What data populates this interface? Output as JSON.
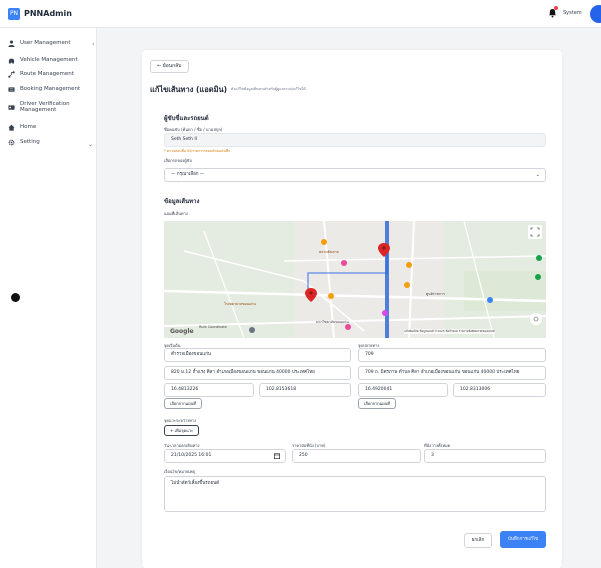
{
  "app": {
    "title": "PNNAdmin",
    "logo_text": "PN",
    "user_name": "System"
  },
  "sidebar": {
    "items": [
      {
        "label": "User Management"
      },
      {
        "label": "Vehicle Management"
      },
      {
        "label": "Route Management"
      },
      {
        "label": "Booking Management"
      },
      {
        "label": "Driver Verification Management"
      },
      {
        "label": "Home"
      },
      {
        "label": "Setting"
      }
    ]
  },
  "page": {
    "back_label": "← ย้อนกลับ",
    "title": "แก้ไขเส้นทาง (แอดมิน)",
    "subtitle": "ตัวแก้ไขข้อมูลเส้นทางสำหรับผู้ดูแลระบบ/แก้ไขได้"
  },
  "driver_section": {
    "title": "ผู้ขับขี่และรถยนต์",
    "driver_label": "ชื่อคนขับ (ค้นหา / ชื่อ / นามสกุล)",
    "driver_value": "Seth Seth II",
    "warning": "* ตรวจสอบชื่อ ID/รายการรถยนต์ก่อนบันทึก",
    "vehicle_label": "เลือกรถของผู้ขับ",
    "vehicle_value": "— กรุณาเลือก —"
  },
  "route_section": {
    "title": "ข้อมูลเส้นทาง",
    "map_label": "แผนที่เส้นทาง",
    "map_google": "Google",
    "map_attribution": "แป้นพิมพ์ลัด ข้อมูลแผนที่ ©2025 ข้อกำหนด รายงานข้อผิดพลาดของแผนที่",
    "map_places": [
      "โรงพยาบาลขอนแก่น",
      "มหาวิทยาลัยขอนแก่น",
      "Rule Coordinate",
      "ตลาดต้นตาล",
      "ศูนย์ราชการ"
    ],
    "origin_label": "จุดเริ่มต้น",
    "origin_name": "ตำรวจเมืองขอนแก่น",
    "origin_address": "820 ม.12 ถ้ำแรง ศิลา อำเภอเมืองขอนแก่น ขอนแก่น 40000 ประเทศไทย",
    "origin_lat": "16.4813226",
    "origin_lng": "102.8153618",
    "origin_pick": "เลือกจากแผนที่",
    "dest_label": "จุดปลายทาง",
    "dest_name": "709",
    "dest_address": "709 ถ. มิตรภาพ ตำบล ศิลา อำเภอเมืองขอนแก่น ขอนแก่น 40000 ประเทศไทย",
    "dest_lat": "16.4920041",
    "dest_lng": "102.8313006",
    "dest_pick": "เลือกจากแผนที่",
    "stops_label": "จุดแวะระหว่างทาง",
    "add_stop": "+ เพิ่มจุดแวะ",
    "depart_label": "วัน-เวลาออกเดินทาง",
    "depart_value": "21/10/2025 16:01",
    "price_label": "ราคาต่อที่นั่ง (บาท)",
    "price_value": "250",
    "seats_label": "ที่นั่งว่างทั้งหมด",
    "seats_value": "3",
    "note_label": "เงื่อนไข/หมายเหตุ",
    "note_value": "ไม่นำสัตว์เลี้ยงขึ้นรถยนต์"
  },
  "actions": {
    "cancel": "ยกเลิก",
    "save": "บันทึกการแก้ไข"
  },
  "colors": {
    "primary": "#3b82f6",
    "warning": "#d97706",
    "marker": "#dc2626"
  }
}
